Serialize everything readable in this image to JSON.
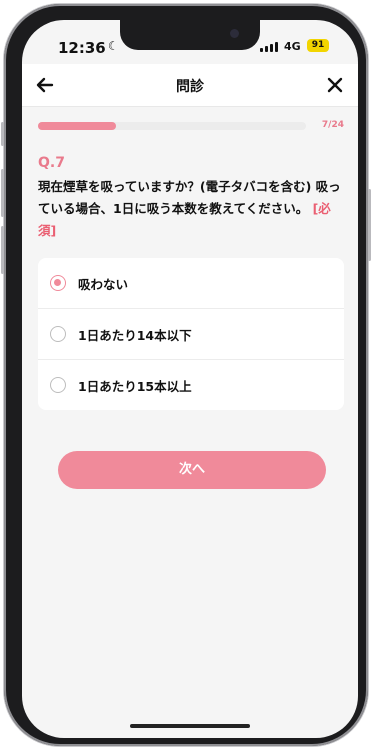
{
  "status": {
    "time": "12:36",
    "network": "4G",
    "battery": "91"
  },
  "header": {
    "title": "問診",
    "back_icon": "arrow-left-icon",
    "close_icon": "close-icon"
  },
  "progress": {
    "text": "7/24",
    "current": 7,
    "total": 24
  },
  "question": {
    "number": "Q.7",
    "text": "現在煙草を吸っていますか？(電子タバコを含む) 吸っている場合、1日に吸う本数を教えてください。",
    "required": "[必須]"
  },
  "options": [
    {
      "label": "吸わない",
      "selected": true
    },
    {
      "label": "1日あたり14本以下",
      "selected": false
    },
    {
      "label": "1日あたり15本以上",
      "selected": false
    }
  ],
  "next_button": {
    "label": "次へ"
  },
  "colors": {
    "accent": "#f08a9a",
    "required": "#ea5f72"
  }
}
